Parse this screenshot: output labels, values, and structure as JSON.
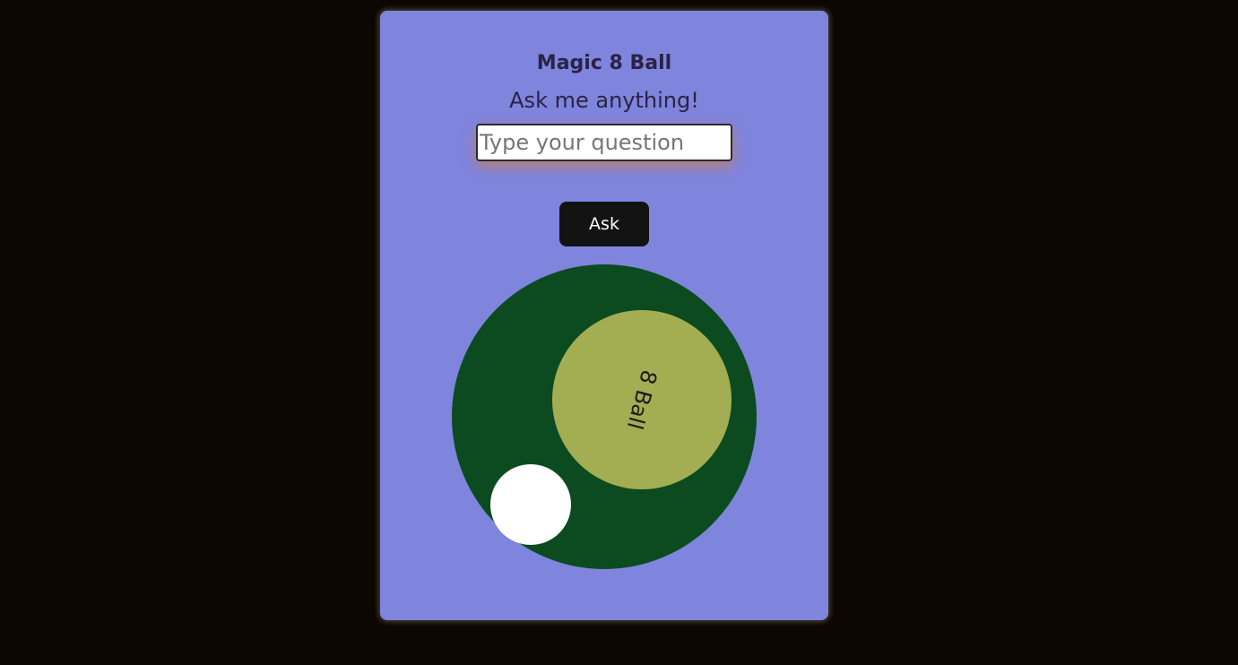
{
  "app": {
    "title": "Magic 8 Ball",
    "subtitle": "Ask me anything!"
  },
  "question": {
    "placeholder": "Type your question",
    "value": ""
  },
  "ask_button": {
    "label": "Ask"
  },
  "ball": {
    "label": "8 Ball"
  },
  "colors": {
    "page_background": "#0c0702",
    "card_background": "#7f84dc",
    "ball": "#0b4b1f",
    "ball_window": "#a3ad52",
    "button": "#131313"
  }
}
